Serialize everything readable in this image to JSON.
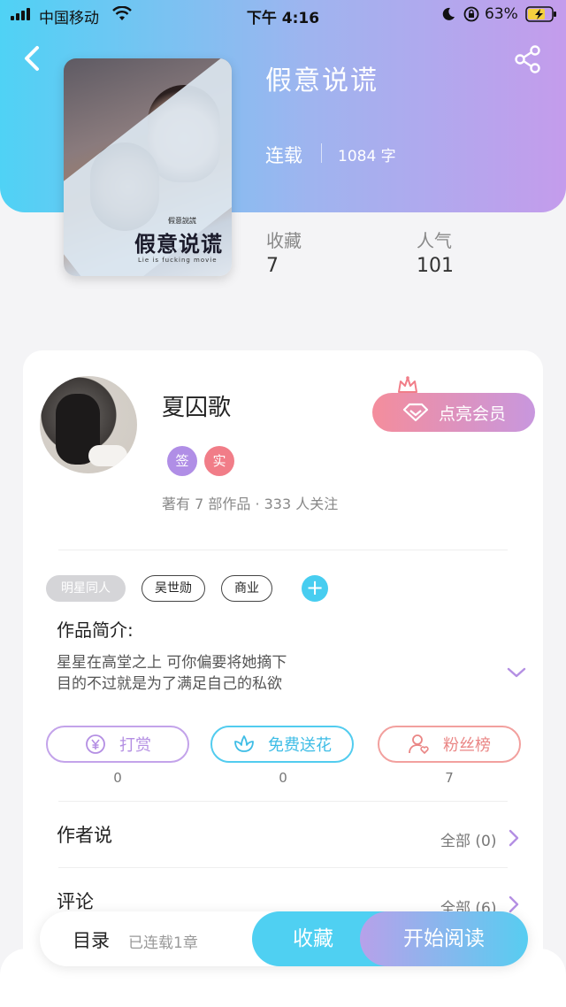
{
  "status_bar": {
    "carrier": "中国移动",
    "time": "下午 4:16",
    "battery": "63%"
  },
  "book": {
    "title": "假意说谎",
    "status": "连载",
    "word_count": "1084 字",
    "cover": {
      "title": "假意说谎",
      "subtitle": "Lie is fucking movie",
      "tag": "假意說謊"
    },
    "stats": {
      "favorites_label": "收藏",
      "favorites_value": "7",
      "popularity_label": "人气",
      "popularity_value": "101"
    }
  },
  "author": {
    "name": "夏囚歌",
    "badges": [
      "签",
      "实"
    ],
    "stats": "著有 7 部作品 · 333 人关注",
    "vip_label": "点亮会员"
  },
  "tags": [
    "明星同人",
    "吴世勋",
    "商业"
  ],
  "intro": {
    "heading": "作品简介:",
    "lines": [
      "星星在高堂之上 可你偏要将她摘下",
      "目的不过就是为了满足自己的私欲"
    ]
  },
  "actions": [
    {
      "label": "打赏",
      "count": "0",
      "icon": "yen-coin-icon",
      "color": "#b48fe3"
    },
    {
      "label": "免费送花",
      "count": "0",
      "icon": "flower-icon",
      "color": "#3fbde6"
    },
    {
      "label": "粉丝榜",
      "count": "7",
      "icon": "fan-user-heart-icon",
      "color": "#ea8685"
    }
  ],
  "sections": [
    {
      "title": "作者说",
      "all": "全部 (0)"
    },
    {
      "title": "评论",
      "all": "全部 (6)"
    }
  ],
  "bottom": {
    "toc": "目录",
    "chapters": "已连载1章",
    "collect": "收藏",
    "read": "开始阅读"
  },
  "colors": {
    "header_start": "#4fd2f5",
    "header_end": "#c49cec",
    "accent_blue": "#4fd0f2",
    "accent_purple": "#b7a1ea",
    "accent_pink": "#f48d9c"
  }
}
